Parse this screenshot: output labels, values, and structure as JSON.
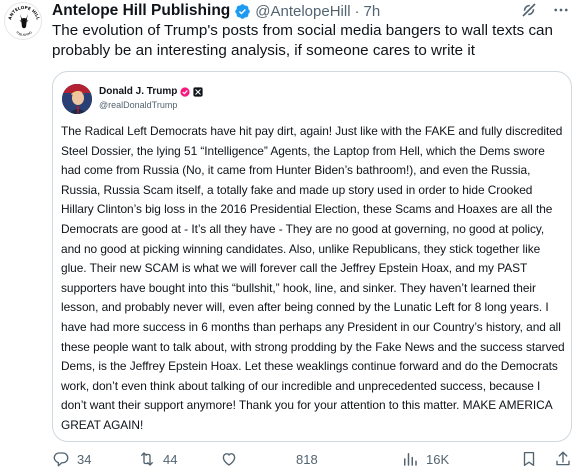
{
  "tweet": {
    "author_name": "Antelope Hill Publishing",
    "handle": "@AntelopeHill",
    "separator": "·",
    "time": "7h",
    "logo_text": "ANTELOPE HILL PUBLISHING",
    "text": "The evolution of Trump's posts from social media bangers to wall texts can probably be an interesting analysis, if someone cares to write it"
  },
  "quote": {
    "author_name": "Donald J. Trump",
    "handle": "@realDonaldTrump",
    "body": "The Radical Left Democrats have hit pay dirt, again! Just like with the FAKE and fully discredited Steel Dossier, the lying 51 “Intelligence” Agents, the Laptop from Hell, which the Dems swore had come from Russia (No, it came from Hunter Biden’s bathroom!), and even the Russia, Russia, Russia Scam itself, a totally fake and made up story used in order to hide Crooked Hillary Clinton’s big loss in the 2016 Presidential Election, these Scams and Hoaxes are all the Democrats are good at - It’s all they have - They are no good at governing, no good at policy, and no good at picking winning candidates. Also, unlike Republicans, they stick together like glue. Their new SCAM is what we will forever call the Jeffrey Epstein Hoax, and my PAST supporters have bought into this “bullshit,” hook, line, and sinker. They haven’t learned their lesson, and probably never will, even after being conned by the Lunatic Left for 8 long years. I have had more success in 6 months than perhaps any President in our Country’s history, and all these people want to talk about, with strong prodding by the Fake News and the  success starved Dems, is the Jeffrey Epstein Hoax. Let these weaklings continue forward and do the Democrats work, don’t even think about talking of our incredible and unprecedented success, because I don’t want their support anymore! Thank you for your attention to this matter. MAKE AMERICA GREAT AGAIN!"
  },
  "actions": {
    "replies": "34",
    "reposts": "44",
    "likes": "",
    "favorites": "818",
    "views": "16K"
  },
  "icons": {
    "verified": "verified-badge-icon",
    "grok": "grok-icon",
    "more": "more-icon",
    "reply": "reply-icon",
    "retweet": "retweet-icon",
    "like": "heart-icon",
    "views": "views-icon",
    "bookmark": "bookmark-icon",
    "share": "share-icon"
  },
  "colors": {
    "verified": "#1d9bf0",
    "text": "#0f1419",
    "muted": "#536471",
    "border": "#cfd9de",
    "quote_badge": "#f91880"
  }
}
